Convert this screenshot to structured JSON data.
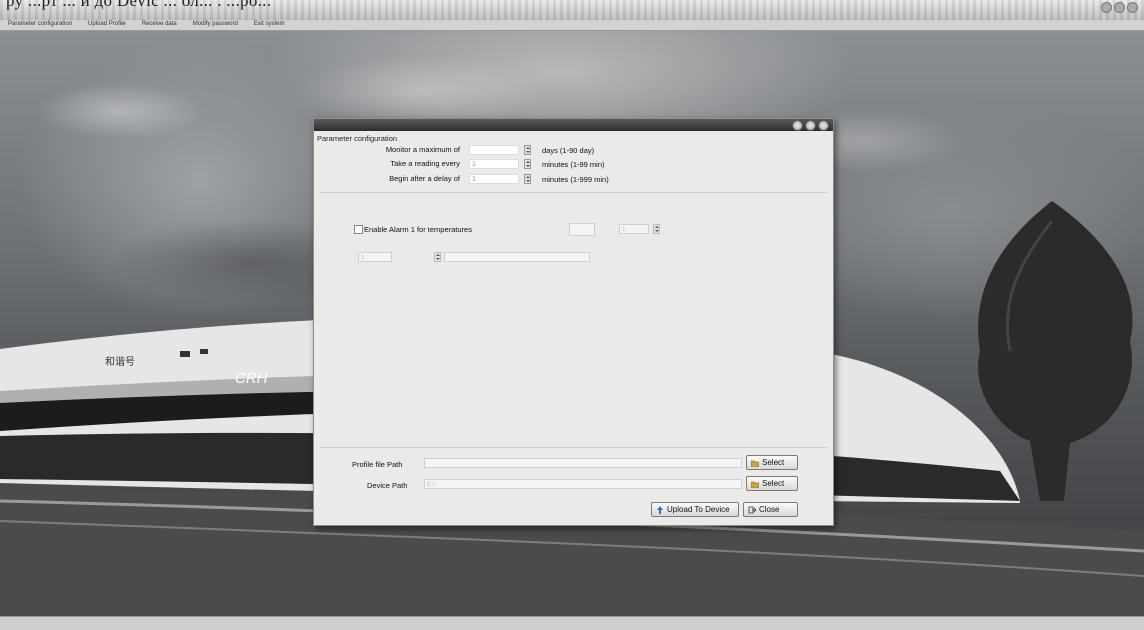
{
  "document": {
    "caption_text": "ру ...рт ... и до Devic ... ол... . ...ро..."
  },
  "menubar": {
    "items": [
      "Parameter configuration",
      "Upload Profile",
      "Receive data",
      "Modify password",
      "Exit system"
    ]
  },
  "dialog": {
    "group_label": "Parameter configuration",
    "rows": [
      {
        "label": "Monitor a maximum of",
        "value": "",
        "unit": "days (1-90 day)"
      },
      {
        "label": "Take a reading every",
        "value": "1",
        "unit": "minutes (1-99 min)"
      },
      {
        "label": "Begin after a delay of",
        "value": "1",
        "unit": "minutes (1-999 min)"
      }
    ],
    "alarm": {
      "label": "Enable Alarm 1 for temperatures",
      "checked": false,
      "low_value": "",
      "count_value": "1",
      "high_value": "1",
      "option_value": "",
      "unit_value": ""
    },
    "profile_path": {
      "label": "Profile file Path",
      "value": ""
    },
    "device_path": {
      "label": "Device Path",
      "value": "E:\\"
    },
    "buttons": {
      "select_profile": "Select",
      "select_device": "Select",
      "upload": "Upload To Device",
      "close": "Close"
    }
  },
  "statusbar": {
    "left": "",
    "center": ""
  },
  "colors": {
    "dialog_bg": "#eceae8",
    "titlebar": "#2d2d2d",
    "sky": "#8d9093"
  }
}
